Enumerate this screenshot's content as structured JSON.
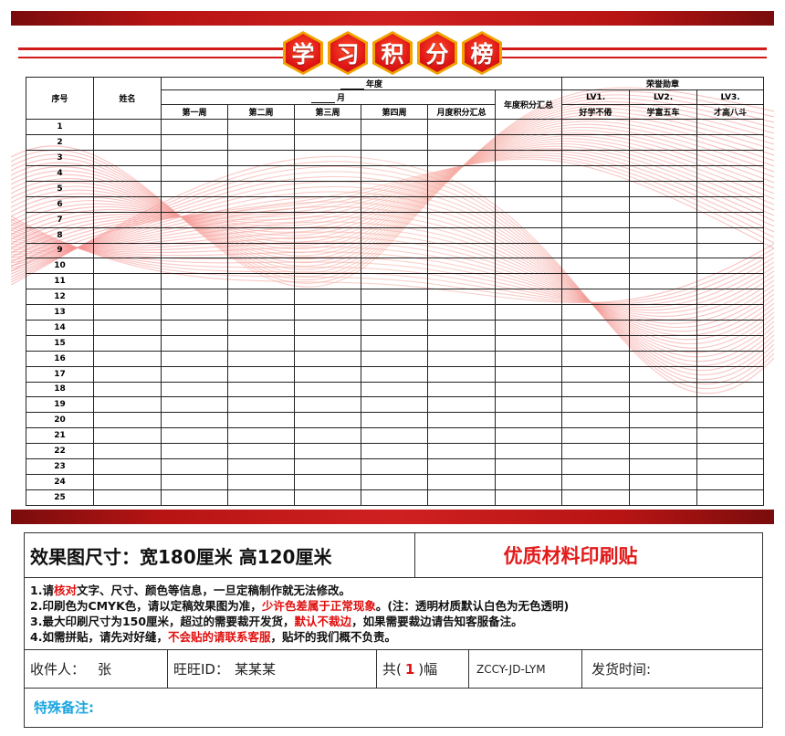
{
  "poster": {
    "title_chars": [
      "学",
      "习",
      "积",
      "分",
      "榜"
    ],
    "table": {
      "header": {
        "index": "序号",
        "name": "姓名",
        "year": "年度",
        "month": "月",
        "weeks": [
          "第一周",
          "第二周",
          "第三周",
          "第四周",
          "月度积分汇总"
        ],
        "year_total": "年度积分汇总",
        "honor": "荣誉勋章",
        "levels": [
          {
            "level": "LV1.",
            "title": "好学不倦"
          },
          {
            "level": "LV2.",
            "title": "学富五车"
          },
          {
            "level": "LV3.",
            "title": "才高八斗"
          }
        ]
      },
      "rows": [
        "1",
        "2",
        "3",
        "4",
        "5",
        "6",
        "7",
        "8",
        "9",
        "10",
        "11",
        "12",
        "13",
        "14",
        "15",
        "16",
        "17",
        "18",
        "19",
        "20",
        "21",
        "22",
        "23",
        "24",
        "25"
      ]
    }
  },
  "order": {
    "size_text": "效果图尺寸：宽180厘米  高120厘米",
    "quality_text": "优质材料印刷贴",
    "notes": {
      "n1_a": "1.请",
      "n1_red": "核对",
      "n1_b": "文字、尺寸、颜色等信息，一旦定稿制作就无法修改。",
      "n2_a": "2.印刷色为CMYK色，请以定稿效果图为准，",
      "n2_red": "少许色差属于正常现象",
      "n2_b": "。(注：透明材质默认白色为无色透明)",
      "n3_a": "3.最大印刷尺寸为150厘米，超过的需要裁开发货，",
      "n3_red": "默认不裁边",
      "n3_b": "，如果需要裁边请告知客服备注。",
      "n4_a": "4.如需拼贴，请先对好缝，",
      "n4_red": "不会贴的请联系客服",
      "n4_b": "，贴坏的我们概不负责。"
    },
    "recipient_label": "收件人：",
    "recipient_value": "张",
    "wangwang_label": "旺旺ID：",
    "wangwang_value": "某某某",
    "qty_prefix": "共(",
    "qty_value": "1",
    "qty_suffix": ")幅",
    "code": "ZCCY-JD-LYM",
    "ship_time_label": "发货时间:",
    "special_label": "特殊备注:"
  },
  "colors": {
    "accent_red": "#d11a1a",
    "note_red": "#e01010",
    "special_blue": "#1da6e0",
    "title_gold": "#f0a400"
  }
}
